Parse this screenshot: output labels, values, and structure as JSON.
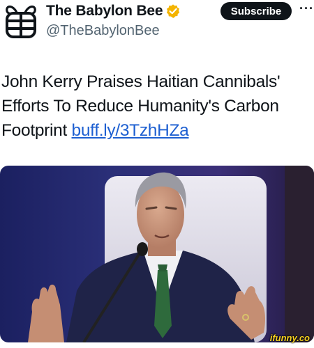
{
  "profile": {
    "display_name": "The Babylon Bee",
    "handle": "@TheBabylonBee",
    "avatar_icon": "bee-logo-icon",
    "verified_icon": "verified-badge-icon",
    "verified_color": "#f4b400"
  },
  "actions": {
    "subscribe_label": "Subscribe",
    "more_label": "···"
  },
  "tweet": {
    "text": "John Kerry Praises Haitian Cannibals' Efforts To Reduce Humanity's Carbon Footprint ",
    "link_text": "buff.ly/3TzhHZa",
    "link_color": "#1d5fd1"
  },
  "media": {
    "photo_description_icon": "photo-man-speaking-at-microphone"
  },
  "watermark": {
    "text": "ifunny.co"
  }
}
